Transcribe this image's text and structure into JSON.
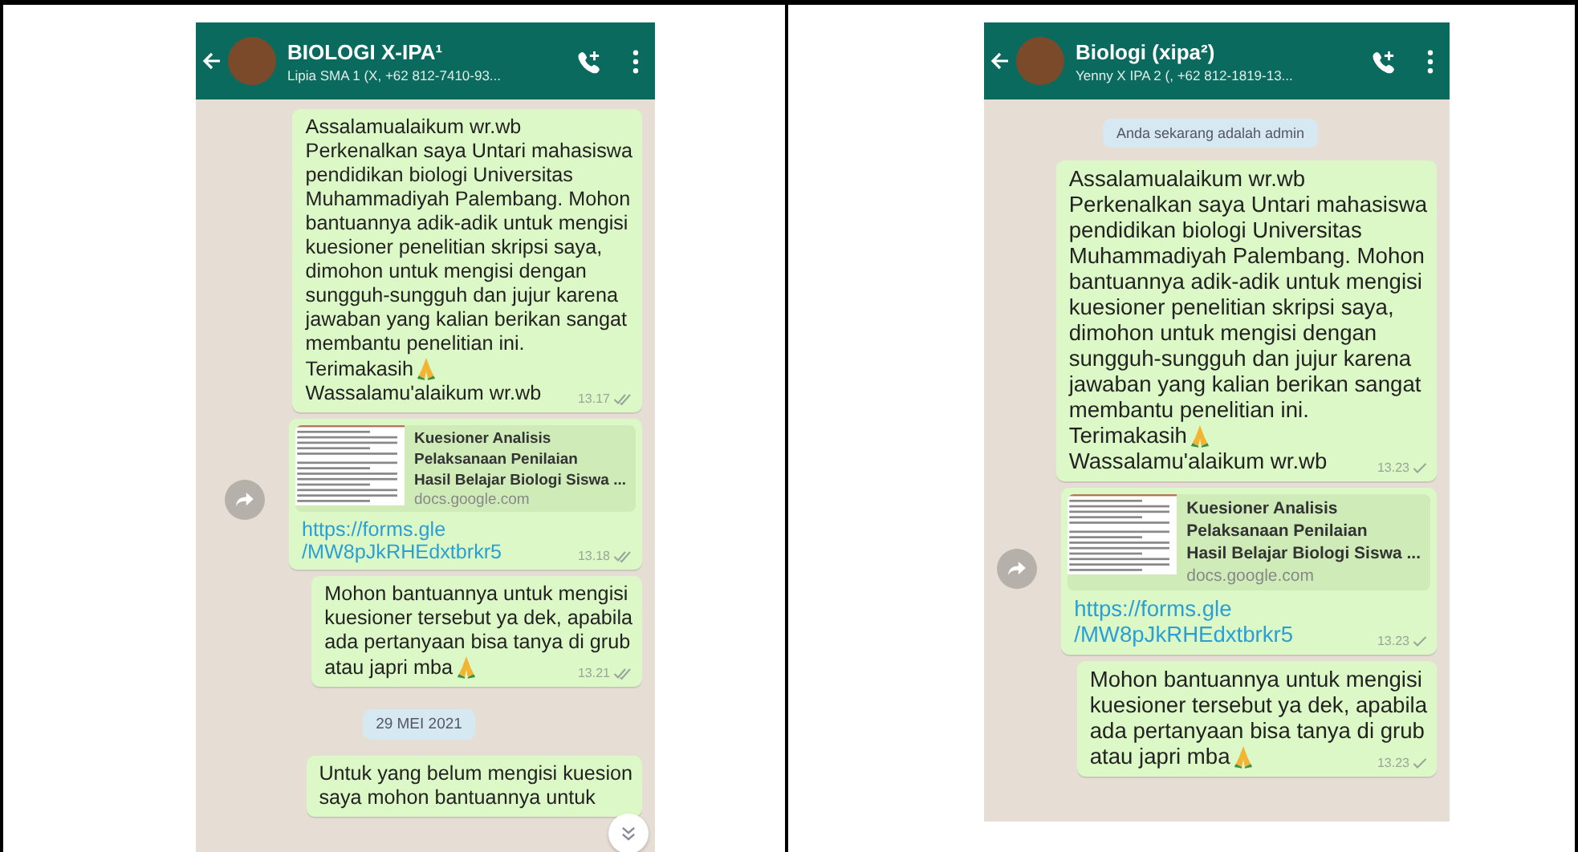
{
  "panels": [
    {
      "header": {
        "title": "BIOLOGI X-IPA¹",
        "subtitle": "Lipia SMA 1 (X, +62 812-7410-93..."
      },
      "items": [
        {
          "kind": "message",
          "blocks": [
            {
              "text": "Assalamualaikum wr.wb\nPerkenalkan saya Untari mahasiswa\npendidikan biologi Universitas\nMuhammadiyah Palembang. Mohon\nbantuannya adik-adik untuk mengisi\nkuesioner penelitian skripsi saya,\ndimohon untuk mengisi dengan\nsungguh-sungguh dan jujur karena\njawaban yang kalian berikan sangat\nmembantu penelitian ini.",
              "emoji": false
            },
            {
              "text": "Terimakasih",
              "emoji": true
            },
            {
              "text": "Wassalamu'alaikum wr.wb",
              "emoji": false
            }
          ],
          "time": "13.17",
          "read": true
        },
        {
          "kind": "link",
          "preview": {
            "title": "Kuesioner Analisis\nPelaksanaan Penilaian\nHasil Belajar Biologi Siswa ...",
            "domain": "docs.google.com"
          },
          "url": "https://forms.gle\n/MW8pJkRHEdxtbrkr5",
          "forward": true,
          "time": "13.18",
          "read": true
        },
        {
          "kind": "message",
          "blocks": [
            {
              "text": "Mohon bantuannya untuk mengisi\nkuesioner tersebut ya dek, apabila\nada pertanyaan bisa tanya di grub",
              "emoji": false
            },
            {
              "text": "atau japri mba",
              "emoji": true
            }
          ],
          "time": "13.21",
          "read": true
        },
        {
          "kind": "date",
          "text": "29 MEI 2021"
        },
        {
          "kind": "message",
          "blocks": [
            {
              "text": "Untuk yang belum mengisi kuesion\nsaya mohon bantuannya untuk",
              "emoji": false
            }
          ]
        }
      ],
      "scroll_down_button": true
    },
    {
      "header": {
        "title": "Biologi (xipa²)",
        "subtitle": "Yenny X IPA 2 (, +62 812-1819-13..."
      },
      "items": [
        {
          "kind": "system",
          "text": "Anda sekarang adalah admin"
        },
        {
          "kind": "message",
          "blocks": [
            {
              "text": "Assalamualaikum wr.wb\nPerkenalkan saya Untari mahasiswa\npendidikan biologi Universitas\nMuhammadiyah Palembang. Mohon\nbantuannya adik-adik untuk mengisi\nkuesioner penelitian skripsi saya,\ndimohon untuk mengisi dengan\nsungguh-sungguh dan jujur karena\njawaban yang kalian berikan sangat\nmembantu penelitian ini.",
              "emoji": false
            },
            {
              "text": "Terimakasih",
              "emoji": true
            },
            {
              "text": "Wassalamu'alaikum wr.wb",
              "emoji": false
            }
          ],
          "time": "13.23",
          "read": false
        },
        {
          "kind": "link",
          "preview": {
            "title": "Kuesioner Analisis\nPelaksanaan Penilaian\nHasil Belajar Biologi Siswa ...",
            "domain": "docs.google.com"
          },
          "url": "https://forms.gle\n/MW8pJkRHEdxtbrkr5",
          "forward": true,
          "time": "13.23",
          "read": false
        },
        {
          "kind": "message",
          "blocks": [
            {
              "text": "Mohon bantuannya untuk mengisi\nkuesioner tersebut ya dek, apabila\nada pertanyaan bisa tanya di grub",
              "emoji": false
            },
            {
              "text": "atau japri mba",
              "emoji": true
            }
          ],
          "time": "13.23",
          "read": false
        }
      ],
      "scroll_down_button": false
    }
  ]
}
